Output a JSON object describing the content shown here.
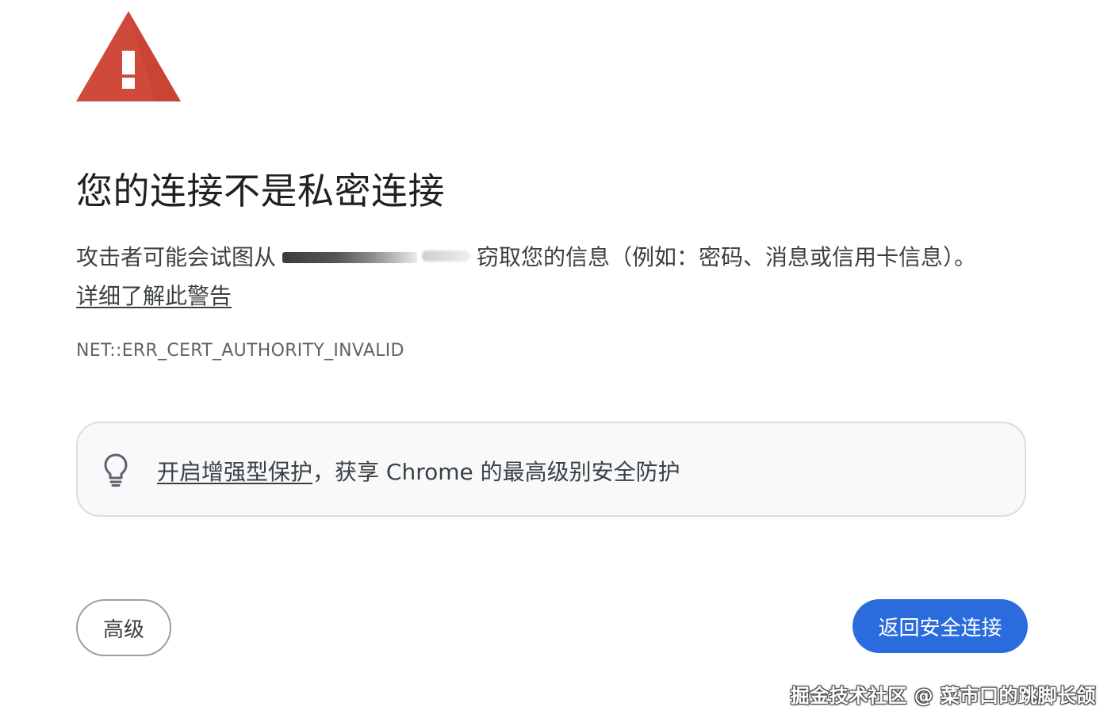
{
  "warning": {
    "icon": "warning-triangle-icon",
    "color": "#d04a3b"
  },
  "heading": {
    "title": "您的连接不是私密连接"
  },
  "explanation": {
    "text_before_host": "攻击者可能会试图从",
    "text_after_host": "窃取您的信息（例如：密码、消息或信用卡信息）。",
    "learn_more_link": "详细了解此警告"
  },
  "error_code": "NET::ERR_CERT_AUTHORITY_INVALID",
  "enhanced_protection": {
    "icon": "lightbulb-icon",
    "link_text": "开启增强型保护",
    "rest_text": "，获享 Chrome 的最高级别安全防护"
  },
  "buttons": {
    "advanced_label": "高级",
    "back_to_safety_label": "返回安全连接"
  },
  "watermark": "掘金技术社区 @ 菜市口的跳脚长颌",
  "colors": {
    "primary_button": "#2a6bde",
    "warning_red": "#d04a3b"
  }
}
